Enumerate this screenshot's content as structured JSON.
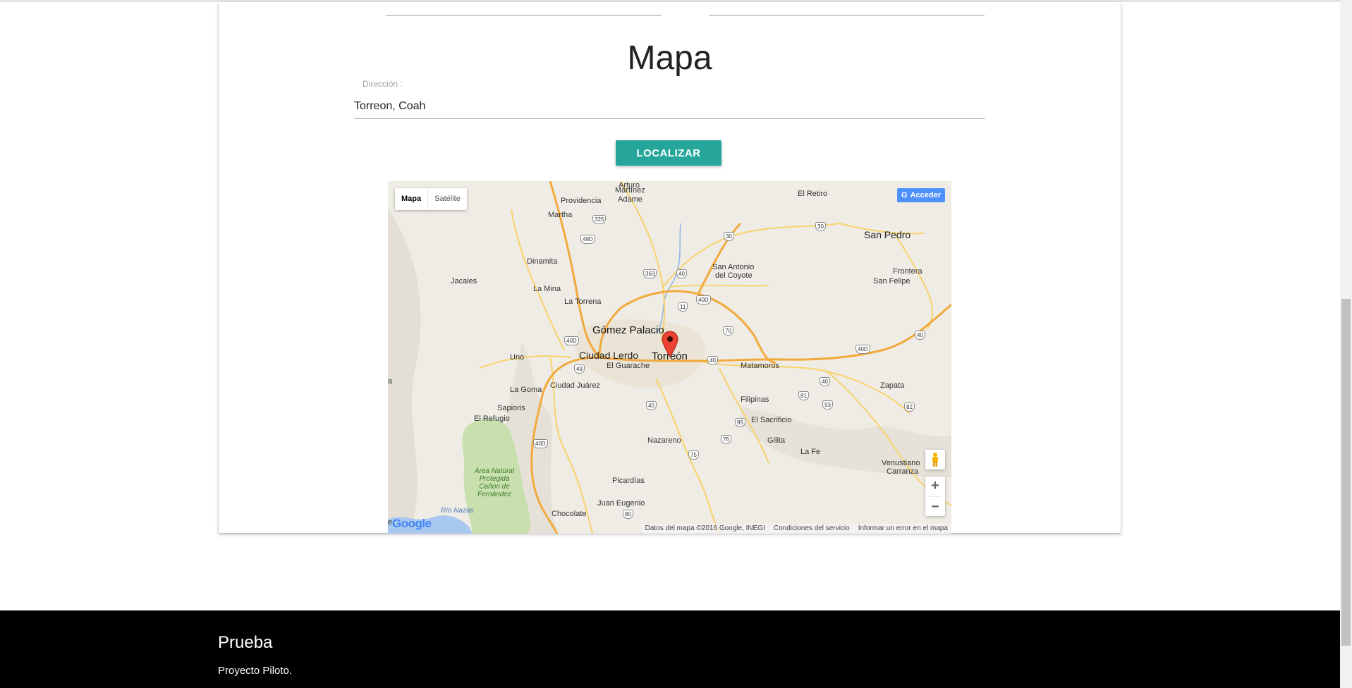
{
  "page": {
    "title": "Mapa",
    "address_label": "Dirección :",
    "address_value": "Torreon, Coah",
    "locate_button": "LOCALIZAR"
  },
  "map": {
    "type_controls": [
      "Mapa",
      "Satélite"
    ],
    "sign_in": "Acceder",
    "google_logo": "Google",
    "footer": {
      "data": "Datos del mapa ©2016 Google, INEGI",
      "terms": "Condiciones del servicio",
      "report": "Informar un error en el mapa"
    },
    "labels": {
      "arturo": "Arturo",
      "martinez": "Martínez",
      "adame": "Adame",
      "el_retiro": "El Retiro",
      "providencia": "Providencia",
      "martha": "Martha",
      "san_pedro": "San Pedro",
      "dinamita": "Dinamita",
      "jacales": "Jacales",
      "san_antonio": "San Antonio",
      "del_coyote": "del Coyote",
      "frontera": "Frontera",
      "san_felipe": "San Felipe",
      "la_mina": "La Mina",
      "la_torrena": "La Torrena",
      "gomez_palacio": "Gómez Palacio",
      "ciudad_lerdo": "Ciudad Lerdo",
      "torreon": "Torreón",
      "uno": "Uno",
      "el_guarache": "El Guarache",
      "matamoros": "Matamoros",
      "la_goma": "La Goma",
      "ciudad_juarez": "Ciudad Juárez",
      "zapata": "Zapata",
      "filipinas": "Filipinas",
      "sapioris": "Sapioris",
      "el_refugio": "El Refugio",
      "el_sacrificio": "El Sacrificio",
      "gilita": "Gilita",
      "nazareno": "Nazareno",
      "la_fe": "La Fe",
      "venustiano": "Venustiano",
      "carranza": "Carranza",
      "area_natural_1": "Área Natural",
      "area_natural_2": "Protegida",
      "area_natural_3": "Cañón de",
      "area_natural_4": "Fernández",
      "picardias": "Picardías",
      "juan_eugenio": "Juan Eugenio",
      "rio_nazas": "Río Nazas",
      "chocolate": "Chocolate",
      "edge_a": "a",
      "edge_e": "e"
    },
    "shields": [
      "325",
      "49D",
      "30",
      "30",
      "363",
      "40",
      "40D",
      "11",
      "70",
      "40D",
      "40D",
      "40",
      "49",
      "40",
      "40",
      "81",
      "93",
      "82",
      "40",
      "95",
      "76",
      "40D",
      "75",
      "80"
    ]
  },
  "footer": {
    "title": "Prueba",
    "text": "Proyecto Piloto."
  },
  "colors": {
    "accent": "#26a69a",
    "footer_bg": "#000000",
    "marker": "#ea4335",
    "highway": "#f2a93b",
    "road_minor": "#f7d36b"
  }
}
